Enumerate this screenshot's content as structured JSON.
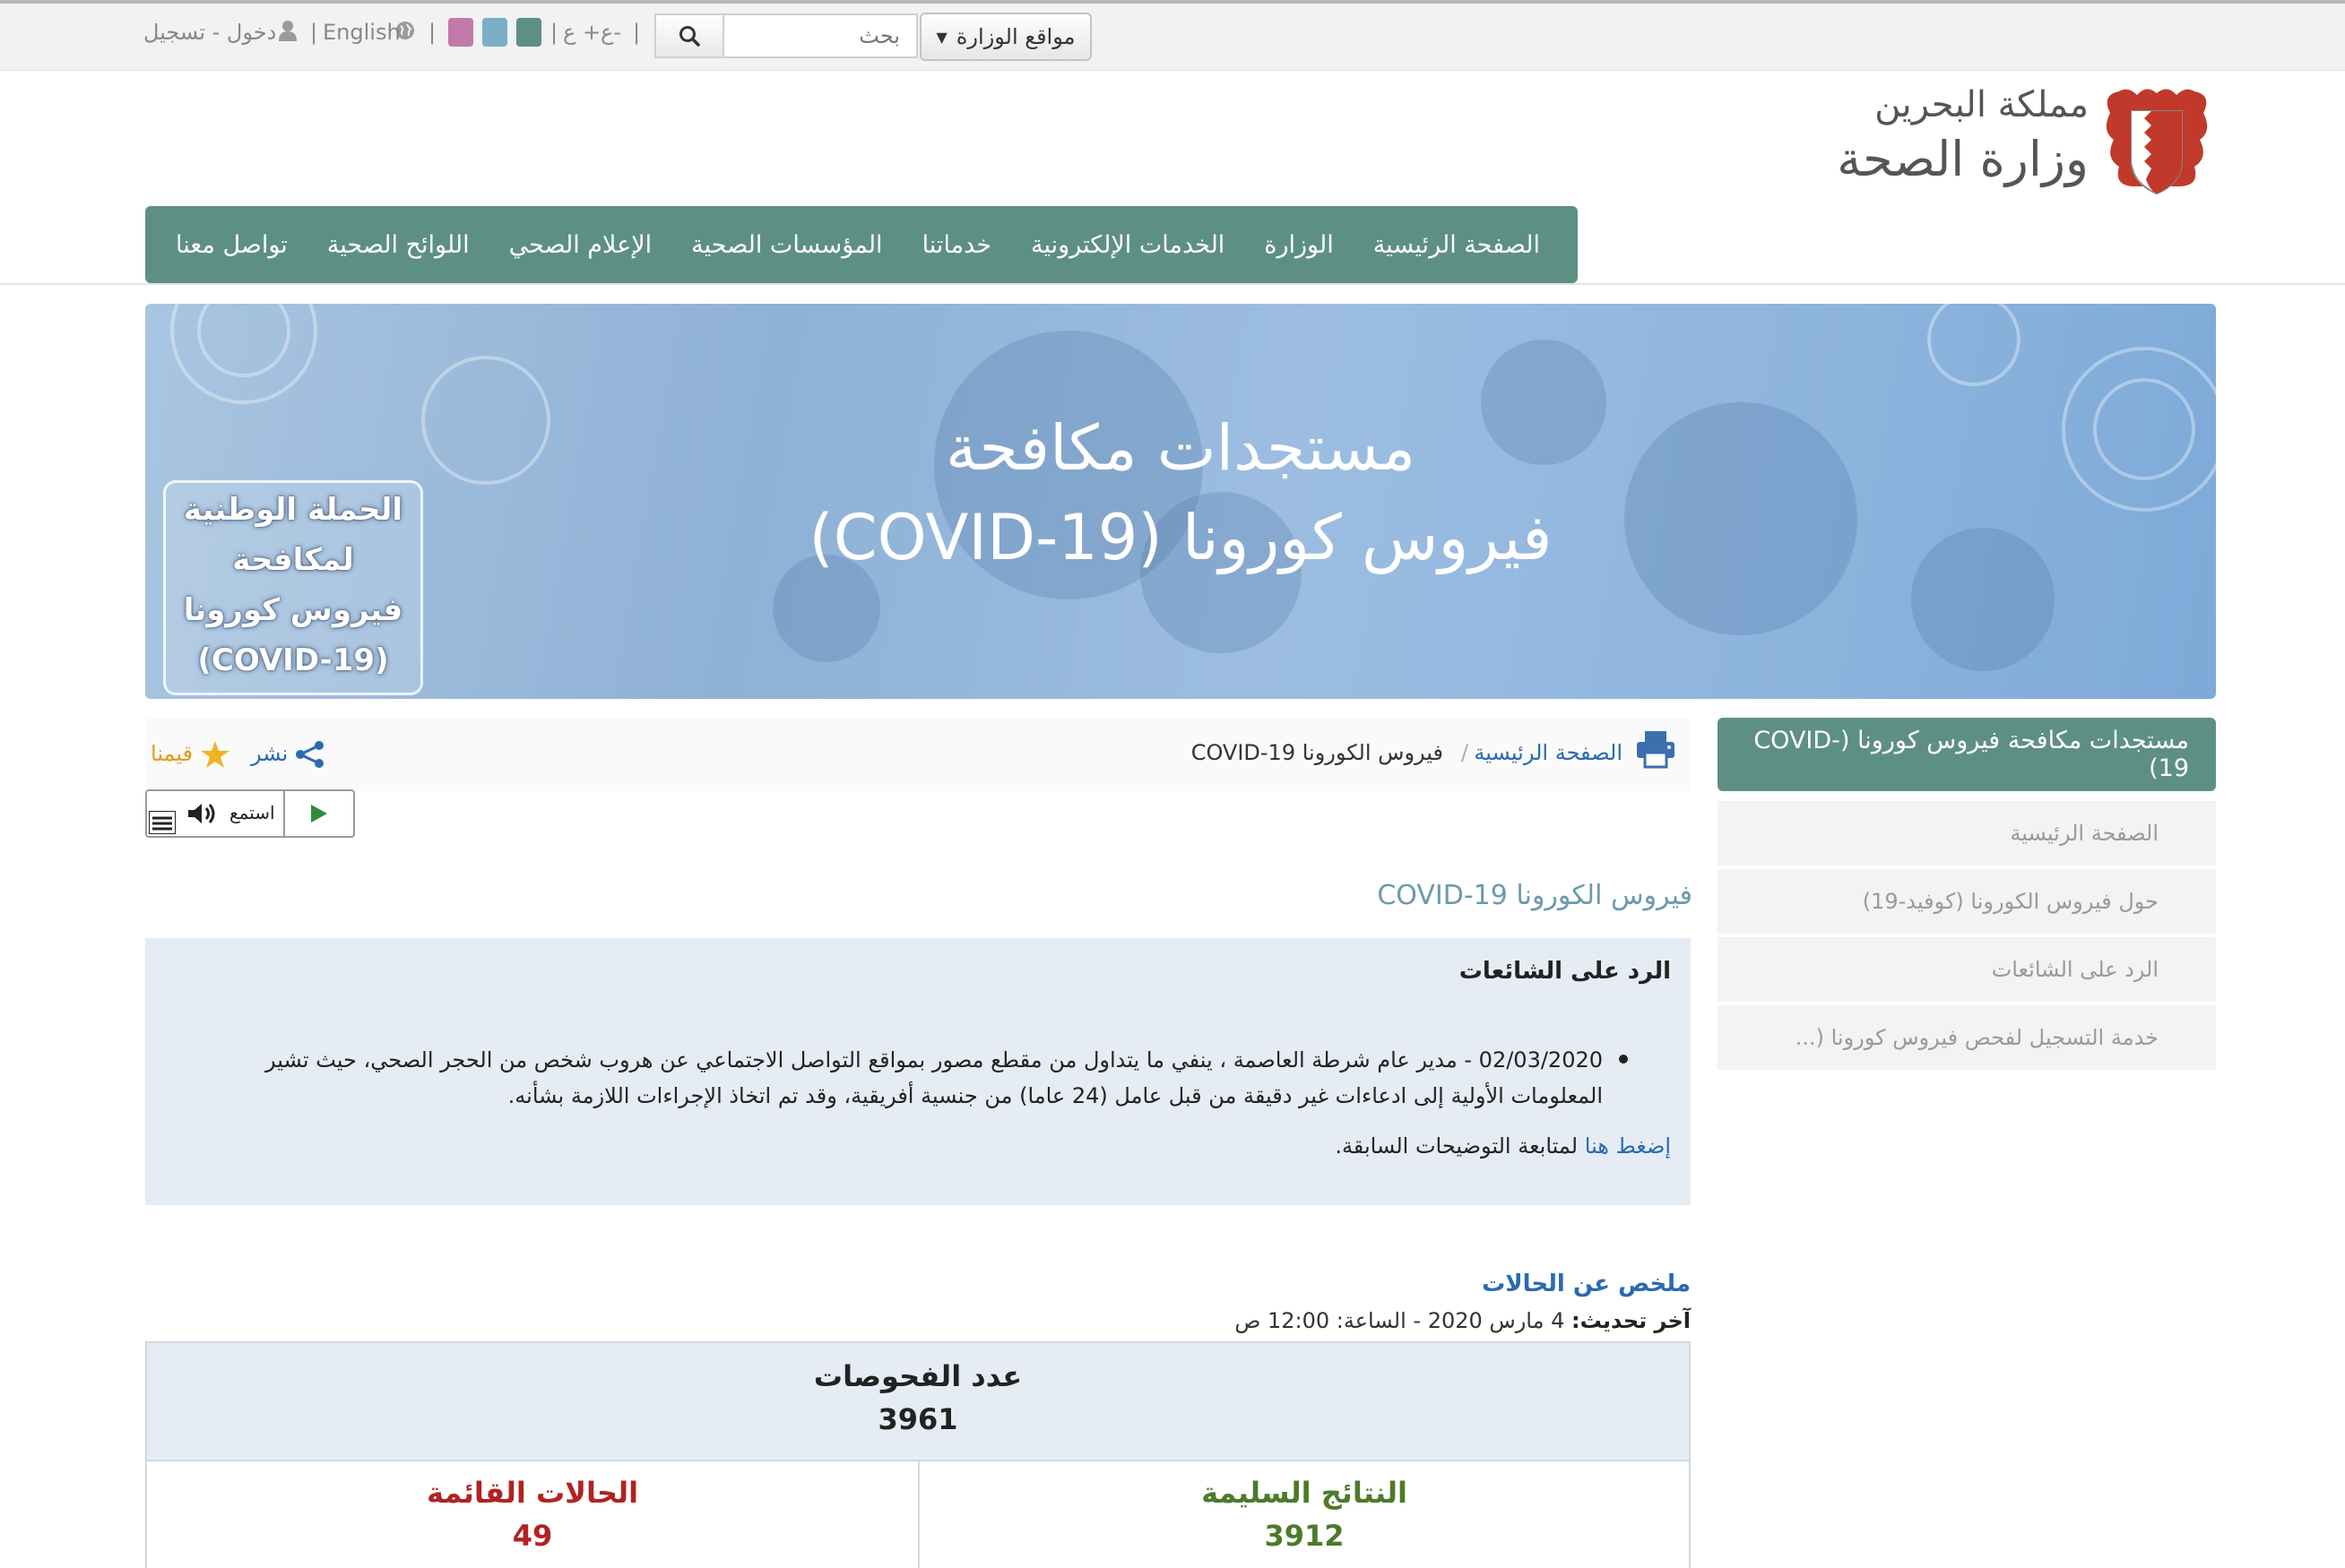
{
  "topbar": {
    "ministry_sites": "مواقع الوزارة",
    "search_placeholder": "بحث",
    "font_size": "ع+ ع-",
    "language": "English",
    "auth": "دخول - تسجيل",
    "swatch_colors": [
      "#5e8f85",
      "#7bafc6",
      "#c27aa8"
    ]
  },
  "header": {
    "logo_line1": "مملكة البحرين",
    "logo_line2": "وزارة الصحة"
  },
  "nav": {
    "items": [
      "الصفحة الرئيسية",
      "الوزارة",
      "الخدمات الإلكترونية",
      "خدماتنا",
      "المؤسسات الصحية",
      "الإعلام الصحي",
      "اللوائح الصحية",
      "تواصل معنا"
    ]
  },
  "banner": {
    "title_line1": "مستجدات مكافحة",
    "title_line2": "فيروس كورونا (COVID-19)",
    "campaign": [
      "الحملة الوطنية",
      "لمكافحة",
      "فيروس كورونا",
      "(COVID-19)"
    ]
  },
  "sidebar": {
    "title": "مستجدات مكافحة فيروس كورونا (COVID-19)",
    "items": [
      "الصفحة الرئيسية",
      "حول فيروس الكورونا (كوفيد-19)",
      "الرد على الشائعات",
      "خدمة التسجيل لفحص فيروس كورونا (..."
    ]
  },
  "breadcrumb": {
    "home": "الصفحة الرئيسية",
    "separator": "/",
    "current": "فيروس الكورونا COVID-19"
  },
  "actions": {
    "share": "نشر",
    "rate": "قيمنا",
    "listen": "استمع"
  },
  "content": {
    "heading": "فيروس الكورونا COVID-19",
    "rumors_title": "الرد على الشائعات",
    "rumor_text": "02/03/2020 - مدير عام شرطة العاصمة ، ينفي ما يتداول من مقطع مصور بمواقع التواصل الاجتماعي عن هروب شخص من الحجر الصحي، حيث تشير المعلومات الأولية إلى ادعاءات غير دقيقة من قبل عامل (24 عاما) من جنسية أفريقية، وقد تم اتخاذ الإجراءات اللازمة بشأنه.",
    "click_here": "إضغط هنا",
    "follow_previous": "لمتابعة التوضيحات السابقة."
  },
  "summary": {
    "title": "ملخص عن الحالات",
    "last_update_label": "آخر تحديث:",
    "last_update_value": "4 مارس 2020 - الساعة: 12:00 ص",
    "tests_label": "عدد الفحوصات",
    "tests_value": "3961",
    "negative_label": "النتائج السليمة",
    "negative_value": "3912",
    "active_label": "الحالات القائمة",
    "active_value": "49",
    "colors": {
      "negative": "#4d7a2a",
      "active": "#b22222"
    }
  }
}
